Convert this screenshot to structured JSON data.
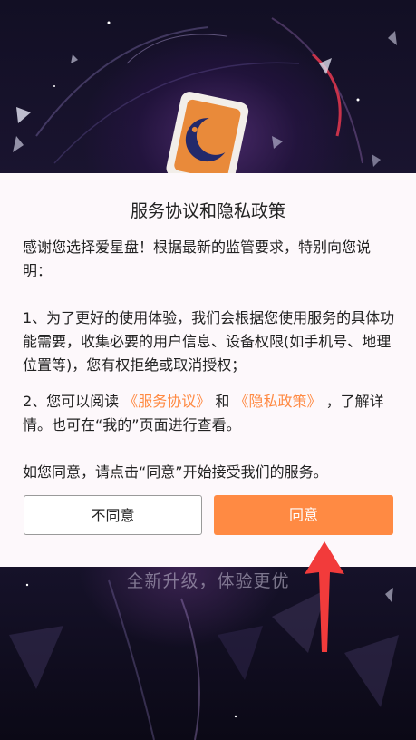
{
  "splash": {
    "tagline": "全新升级，体验更优"
  },
  "dialog": {
    "title": "服务协议和隐私政策",
    "intro": "感谢您选择爱星盘！根据最新的监管要求，特别向您说明：",
    "item1": "1、为了更好的使用体验，我们会根据您使用服务的具体功能需要，收集必要的用户信息、设备权限(如手机号、地理位置等)，您有权拒绝或取消授权；",
    "item2_prefix": "2、您可以阅读 ",
    "service_link": "《服务协议》",
    "item2_and": " 和 ",
    "privacy_link": "《隐私政策》",
    "item2_suffix": " ，了解详情。也可在“我的”页面进行查看。",
    "consent_note": "如您同意，请点击“同意”开始接受我们的服务。",
    "decline_label": "不同意",
    "agree_label": "同意"
  },
  "colors": {
    "accent": "#ff8a43",
    "annotation_arrow": "#f23b3b",
    "dialog_bg": "#fdf8fb"
  },
  "icons": {
    "app_logo": "moon-card-logo-icon",
    "annotation": "red-up-arrow-icon"
  }
}
